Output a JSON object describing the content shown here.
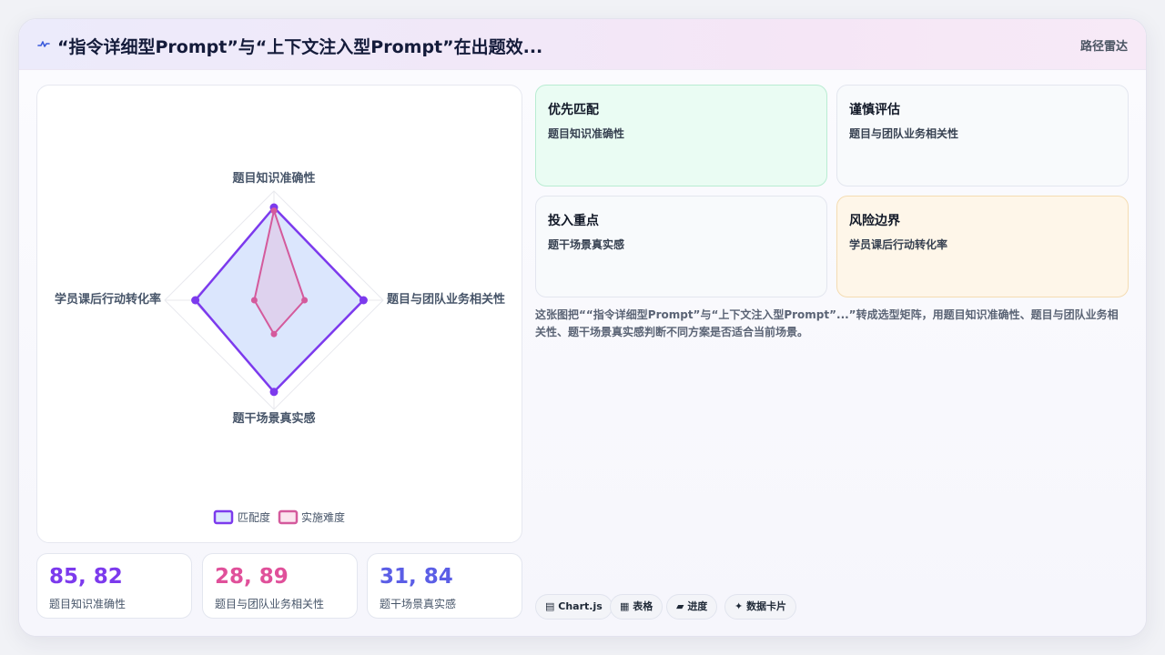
{
  "header": {
    "title": "“指令详细型Prompt”与“上下文注入型Prompt”在出题效...",
    "tag": "路径雷达"
  },
  "chart_data": {
    "type": "radar",
    "axes": [
      "题目知识准确性",
      "题目与团队业务相关性",
      "题干场景真实感",
      "学员课后行动转化率"
    ],
    "rmax": 100,
    "series": [
      {
        "name": "匹配度",
        "values": [
          85,
          82,
          84,
          72
        ],
        "color": "#7c3aed",
        "fill": "#dbe6fd"
      },
      {
        "name": "实施难度",
        "values": [
          82,
          28,
          31,
          18
        ],
        "color": "#d45a9c",
        "fill": "rgba(236,120,170,0.18)"
      }
    ],
    "grid": true,
    "legend": "bottom"
  },
  "kpis": [
    {
      "value": "85, 82",
      "label": "题目知识准确性",
      "color": "#7c3aed"
    },
    {
      "value": "28, 89",
      "label": "题目与团队业务相关性",
      "color": "#e0509a"
    },
    {
      "value": "31, 84",
      "label": "题干场景真实感",
      "color": "#5b5ee6"
    }
  ],
  "quadrants": [
    {
      "title": "优先匹配",
      "desc": "题目知识准确性"
    },
    {
      "title": "谨慎评估",
      "desc": "题目与团队业务相关性"
    },
    {
      "title": "投入重点",
      "desc": "题干场景真实感"
    },
    {
      "title": "风险边界",
      "desc": "学员课后行动转化率"
    }
  ],
  "description": "这张图把““指令详细型Prompt”与“上下文注入型Prompt”...”转成选型矩阵，用题目知识准确性、题目与团队业务相关性、题干场景真实感判断不同方案是否适合当前场景。",
  "chips": [
    {
      "icon": "▤",
      "label": "Chart.js"
    },
    {
      "icon": "▦",
      "label": "表格"
    },
    {
      "icon": "▰",
      "label": "进度"
    },
    {
      "icon": "✦",
      "label": "数据卡片"
    }
  ]
}
